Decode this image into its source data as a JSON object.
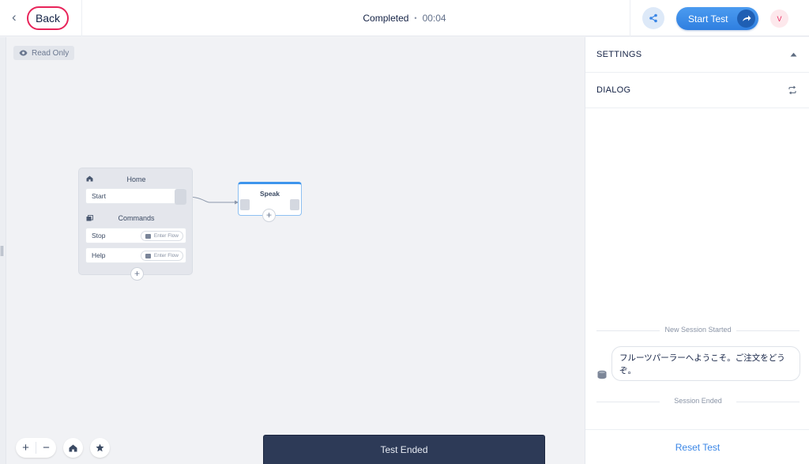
{
  "header": {
    "back_label": "Back",
    "status": "Completed",
    "separator": "•",
    "timer": "00:04",
    "start_label": "Start Test",
    "avatar_initial": "V"
  },
  "canvas": {
    "read_only_label": "Read Only",
    "home_block": {
      "title": "Home",
      "start_step": "Start",
      "commands_title": "Commands",
      "commands": [
        {
          "label": "Stop",
          "action": "Enter Flow"
        },
        {
          "label": "Help",
          "action": "Enter Flow"
        }
      ]
    },
    "speak_block": {
      "title": "Speak"
    },
    "test_ended_label": "Test Ended"
  },
  "panel": {
    "settings_label": "SETTINGS",
    "dialog_label": "DIALOG",
    "new_session_label": "New Session Started",
    "message": "フルーツパーラーへようこそ。ご注文をどうぞ。",
    "session_ended_label": "Session Ended",
    "reset_label": "Reset Test"
  },
  "colors": {
    "accent": "#3a86e6",
    "back_ring": "#e8245a",
    "test_ended_bg": "#2d3a57"
  }
}
